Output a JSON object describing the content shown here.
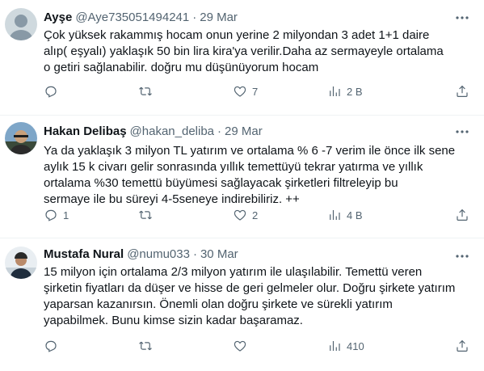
{
  "tweets": [
    {
      "name": "Ayşe",
      "handle": "@Aye735051494241",
      "dot": "·",
      "time": "29 Mar",
      "text_lines": [
        "Çok yüksek rakammış hocam onun yerine 2 milyondan  3 adet 1+1 daire",
        "alıp( eşyalı)  yaklaşık 50 bin lira kira'ya verilir.Daha az sermayeyle ortalama",
        "o getiri sağlanabilir. doğru mu düşünüyorum hocam"
      ],
      "replies": "",
      "retweets": "",
      "likes": "7",
      "views": "2 B"
    },
    {
      "name": "Hakan Delibaş",
      "handle": "@hakan_deliba",
      "dot": "·",
      "time": "29 Mar",
      "text_lines": [
        "Ya da yaklaşık 3 milyon TL yatırım ve ortalama % 6 -7 verim ile önce ilk sene",
        "aylık 15 k civarı gelir sonrasında yıllık temettüyü tekrar yatırma ve yıllık",
        "ortalama %30 temettü büyümesi sağlayacak şirketleri filtreleyip bu",
        "sermaye ile bu süreyi 4-5seneye indirebiliriz. ++"
      ],
      "replies": "1",
      "retweets": "",
      "likes": "2",
      "views": "4 B"
    },
    {
      "name": "Mustafa Nural",
      "handle": "@numu033",
      "dot": "·",
      "time": "30 Mar",
      "text_lines": [
        "15 milyon için ortalama 2/3 milyon yatırım ile ulaşılabilir. Temettü veren",
        "şirketin fiyatları da düşer ve hisse de geri gelmeler olur. Doğru şirkete yatırım",
        "yaparsan kazanırsın.  Önemli olan doğru şirkete ve sürekli yatırım",
        "yapabilmek. Bunu kimse sizin kadar başaramaz."
      ],
      "replies": "",
      "retweets": "",
      "likes": "",
      "views": "410"
    }
  ],
  "icons": [
    "reply-icon",
    "retweet-icon",
    "like-icon",
    "views-icon",
    "share-icon",
    "more-icon"
  ],
  "colors": {
    "text": "#0f1419",
    "secondary": "#536471",
    "divider": "#eff3f4"
  }
}
